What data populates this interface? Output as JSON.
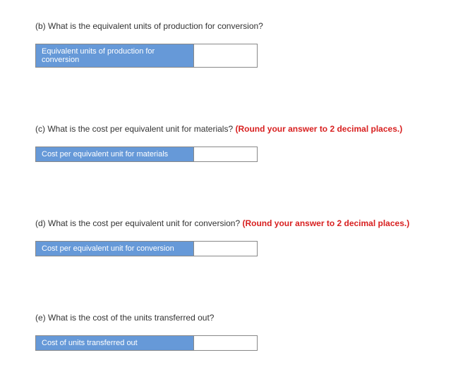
{
  "questions": [
    {
      "prefix": "(b) ",
      "text": "What is the equivalent units of production for conversion?",
      "round": "",
      "label": "Equivalent units of production for conversion",
      "labelWidth": 225,
      "inputWidth": 90,
      "value": ""
    },
    {
      "prefix": "(c) ",
      "text": "What is the cost per equivalent unit for materials? ",
      "round": "(Round your answer to 2 decimal places.)",
      "label": "Cost per equivalent unit for materials",
      "labelWidth": 225,
      "inputWidth": 90,
      "value": ""
    },
    {
      "prefix": "(d) ",
      "text": "What is the cost per equivalent unit for conversion? ",
      "round": "(Round your answer to 2 decimal places.)",
      "label": "Cost per equivalent unit for conversion",
      "labelWidth": 225,
      "inputWidth": 90,
      "value": ""
    },
    {
      "prefix": "(e) ",
      "text": "What is the cost of the units transferred out?",
      "round": "",
      "label": "Cost of units transferred out",
      "labelWidth": 225,
      "inputWidth": 90,
      "value": ""
    }
  ]
}
